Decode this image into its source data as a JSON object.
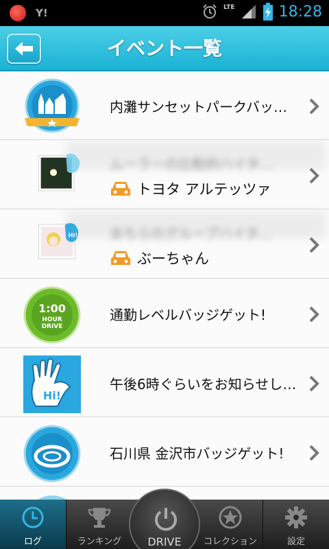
{
  "status_bar": {
    "carrier_icon": "red-circle-icon",
    "yahoo_text": "Y!",
    "network": "LTE",
    "time": "18:28"
  },
  "header": {
    "title": "イベント一覧",
    "back_icon": "back-arrow-icon"
  },
  "events": [
    {
      "title": "内灘サンセットパークバッ…",
      "icon": "badge-building-icon"
    },
    {
      "title_blurred": "ムーラーの比較的ハイタ…",
      "subtitle": "トヨタ アルテッツァ",
      "icon": "photo-with-hi-icon"
    },
    {
      "title_blurred": "あちらのグループハイタ…",
      "subtitle": "ぶーちゃん",
      "icon": "photo-with-hi-icon"
    },
    {
      "title": "通勤レベルバッジゲット!",
      "badge_text": [
        "1:00",
        "HOUR",
        "DRIVE"
      ]
    },
    {
      "title": "午後6時ぐらいをお知らせし…",
      "badge_text": [
        "Hi!"
      ]
    },
    {
      "title": "石川県 金沢市バッジゲット!",
      "icon": "badge-oval-icon"
    }
  ],
  "tabs": [
    {
      "label": "ログ",
      "icon": "clock-icon",
      "active": true
    },
    {
      "label": "ランキング",
      "icon": "trophy-icon",
      "active": false
    },
    {
      "label": "DRIVE",
      "icon": "power-icon",
      "active": false
    },
    {
      "label": "コレクション",
      "icon": "star-badge-icon",
      "active": false
    },
    {
      "label": "設定",
      "icon": "gear-icon",
      "active": false
    }
  ],
  "colors": {
    "accent": "#1ab2d4",
    "badge_blue": "#2aa7df",
    "badge_green": "#6dbb2b",
    "car_orange": "#f39a24"
  }
}
